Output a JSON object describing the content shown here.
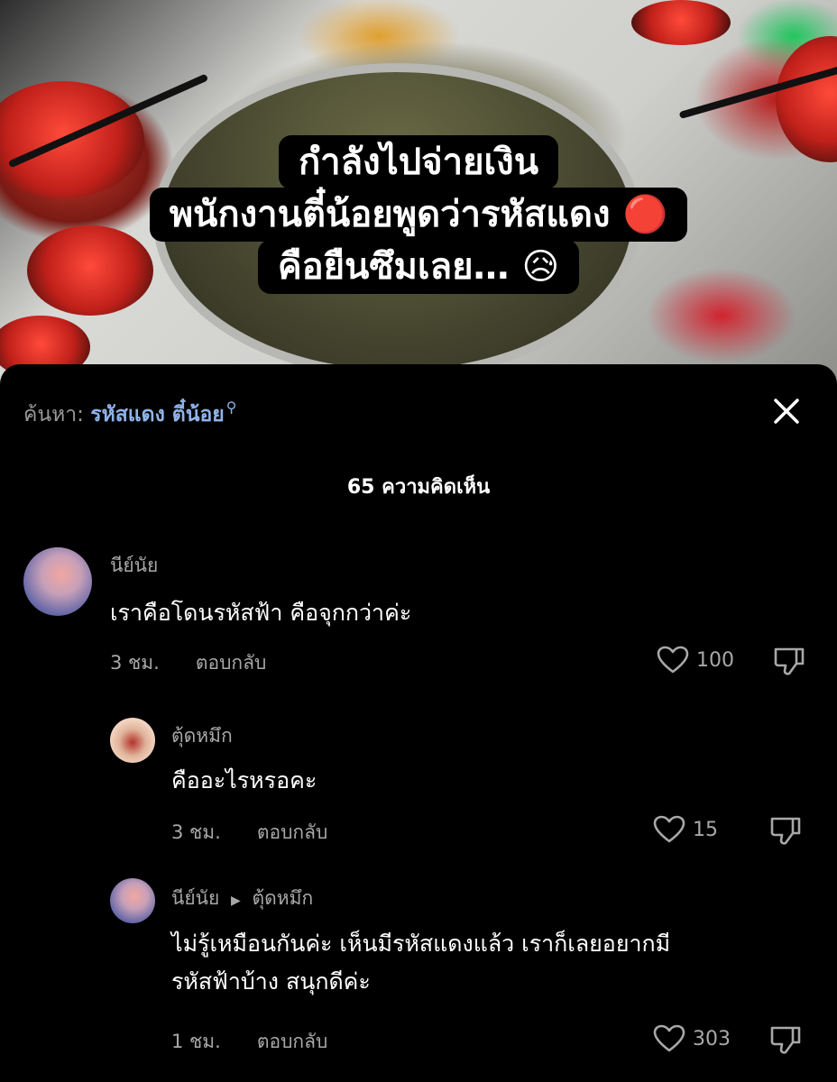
{
  "video": {
    "caption_lines": [
      "กำลังไปจ่ายเงิน",
      "พนักงานตี๋น้อยพูดว่ารหัสแดง 🔴",
      "คือยืนซึมเลย… 😥"
    ]
  },
  "search": {
    "prefix": "ค้นหา:",
    "query": "รหัสแดง ตี๋น้อย"
  },
  "comments_header": {
    "count_label": "65 ความคิดเห็น"
  },
  "comments": [
    {
      "user": "นีย์นัย",
      "text": "เราคือโดนรหัสฟ้า คือจุกกว่าค่ะ",
      "time": "3 ชม.",
      "reply_label": "ตอบกลับ",
      "likes": "100"
    },
    {
      "user": "ตุ้ดหมึก",
      "text": "คืออะไรหรอคะ",
      "time": "3 ชม.",
      "reply_label": "ตอบกลับ",
      "likes": "15"
    },
    {
      "user": "นีย์นัย",
      "reply_to": "ตุ้ดหมึก",
      "text_lines": [
        "ไม่รู้เหมือนกันค่ะ เห็นมีรหัสแดงแล้ว เราก็เลยอยากมี",
        "รหัสฟ้าบ้าง สนุกดีค่ะ"
      ],
      "time": "1 ชม.",
      "reply_label": "ตอบกลับ",
      "likes": "303"
    }
  ],
  "icons": {
    "close": "close-icon",
    "heart": "heart-icon",
    "dislike": "thumbs-down-icon",
    "search": "search-icon"
  },
  "colors": {
    "sheet_bg": "#000000",
    "link": "#8fb3e8",
    "muted": "#a8a8a8",
    "text": "#ffffff"
  }
}
